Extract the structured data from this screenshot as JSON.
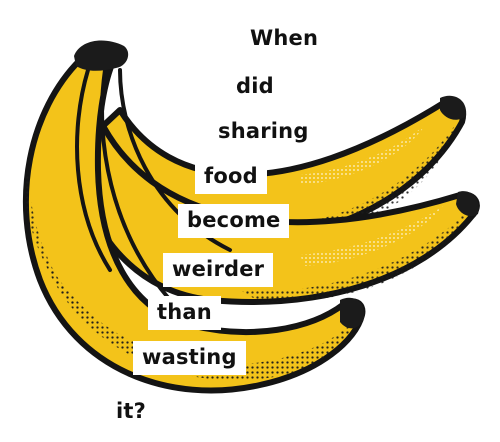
{
  "colors": {
    "banana_yellow": "#F3C31A",
    "banana_shadow": "#D29B0A",
    "outline": "#141414",
    "stem": "#1B1B1B",
    "label_bg": "#FFFFFF",
    "text": "#111111"
  },
  "illustration": {
    "icon": "banana-bunch-icon"
  },
  "message": {
    "words": [
      "When",
      "did",
      "sharing",
      "food",
      "become",
      "weirder",
      "than",
      "wasting",
      "it?"
    ]
  }
}
